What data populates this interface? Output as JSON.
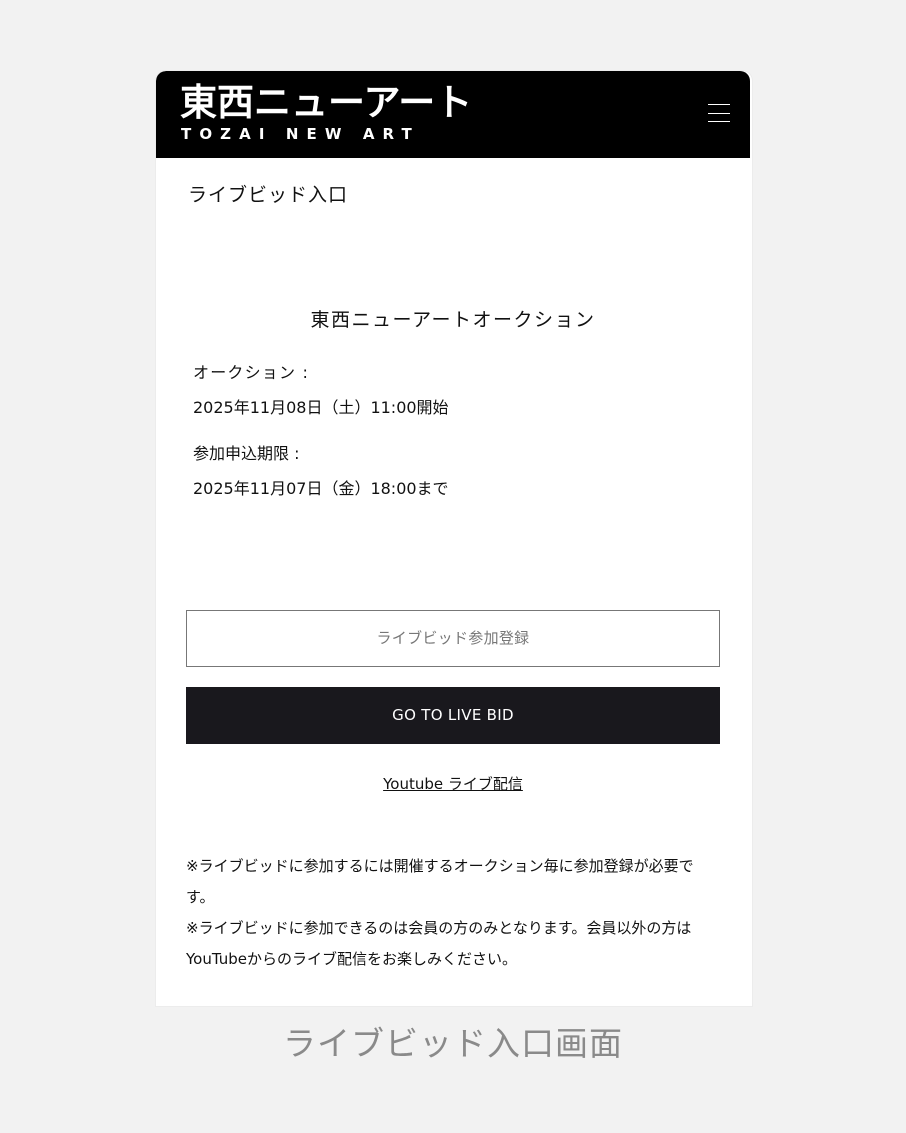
{
  "header": {
    "logo_jp": "東西ニューアート",
    "logo_en": "TOZAI NEW ART",
    "menu_icon": "hamburger-menu-icon",
    "background": "#000000"
  },
  "page": {
    "title": "ライブビッド入口",
    "auction_name": "東西ニューアートオークション",
    "auction_label": "オークション :",
    "auction_value": "2025年11月08日（土）11:00開始",
    "deadline_label": "参加申込期限 :",
    "deadline_value": "2025年11月07日（金）18:00まで"
  },
  "buttons": {
    "register_label": "ライブビッド参加登録",
    "live_bid_label": "GO TO LIVE BID",
    "live_bid_color": "#19181d"
  },
  "links": {
    "youtube_label": "Youtube ライブ配信"
  },
  "notes": [
    "※ライブビッドに参加するには開催するオークション毎に参加登録が必要です。",
    "※ライブビッドに参加できるのは会員の方のみとなります。会員以外の方はYouTubeからのライブ配信をお楽しみください。"
  ],
  "caption": "ライブビッド入口画面"
}
